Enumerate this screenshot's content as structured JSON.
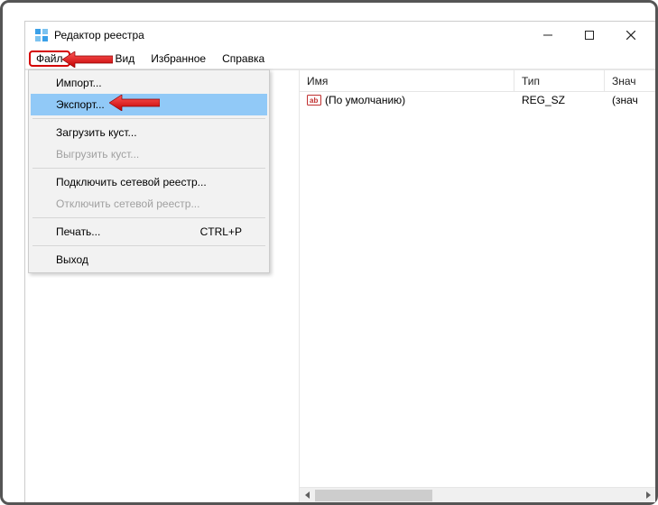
{
  "window": {
    "title": "Редактор реестра"
  },
  "menubar": {
    "file": "Файл",
    "view": "Вид",
    "favorites": "Избранное",
    "help": "Справка"
  },
  "dropdown": {
    "import": "Импорт...",
    "export": "Экспорт...",
    "load_hive": "Загрузить куст...",
    "unload_hive": "Выгрузить куст...",
    "connect_network": "Подключить сетевой реестр...",
    "disconnect_network": "Отключить сетевой реестр...",
    "print": "Печать...",
    "print_shortcut": "CTRL+P",
    "exit": "Выход"
  },
  "list": {
    "headers": {
      "name": "Имя",
      "type": "Тип",
      "value": "Знач"
    },
    "rows": [
      {
        "name": "(По умолчанию)",
        "type": "REG_SZ",
        "value": "(знач"
      }
    ]
  }
}
